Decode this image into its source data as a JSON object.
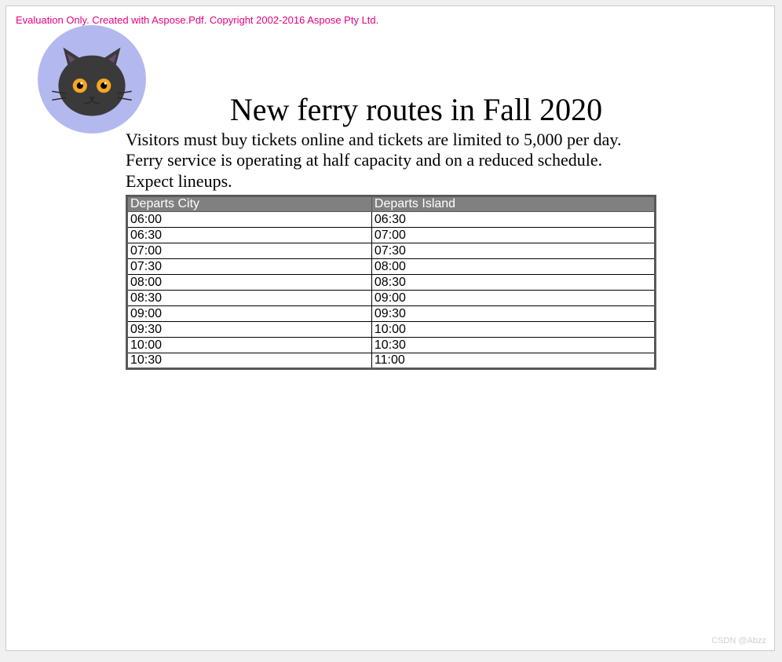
{
  "watermark": "Evaluation Only. Created with Aspose.Pdf. Copyright 2002-2016 Aspose Pty Ltd.",
  "title": "New ferry routes in Fall 2020",
  "description_line1": "Visitors must buy tickets online and tickets are limited to 5,000 per day.",
  "description_line2": "Ferry service is operating at half capacity and on a reduced schedule.",
  "description_line3": "Expect lineups.",
  "table": {
    "headers": {
      "col1": "Departs City",
      "col2": "Departs Island"
    },
    "rows": [
      {
        "col1": "06:00",
        "col2": "06:30"
      },
      {
        "col1": "06:30",
        "col2": "07:00"
      },
      {
        "col1": "07:00",
        "col2": "07:30"
      },
      {
        "col1": "07:30",
        "col2": "08:00"
      },
      {
        "col1": "08:00",
        "col2": "08:30"
      },
      {
        "col1": "08:30",
        "col2": "09:00"
      },
      {
        "col1": "09:00",
        "col2": "09:30"
      },
      {
        "col1": "09:30",
        "col2": "10:00"
      },
      {
        "col1": "10:00",
        "col2": "10:30"
      },
      {
        "col1": "10:30",
        "col2": "11:00"
      }
    ]
  },
  "footer": "CSDN @Abzz"
}
